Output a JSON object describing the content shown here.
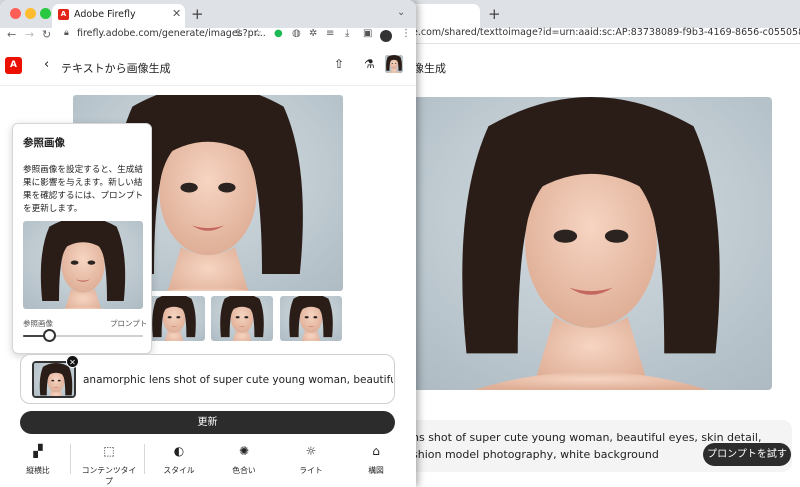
{
  "front_window": {
    "tab_title": "Adobe Firefly",
    "tab_close": "✕",
    "new_tab": "+",
    "tab_overflow": "⌄",
    "url": "firefly.adobe.com/generate/images?pr...",
    "app_title": "テキストから画像生成",
    "reference_popover": {
      "title": "参照画像",
      "description": "参照画像を設定すると、生成結果に影響を与えます。新しい結果を確認するには、プロンプトを更新します。",
      "slider_left_label": "参照画像",
      "slider_right_label": "プロンプト",
      "slider_value": 0.22
    },
    "prompt_text": "anamorphic lens shot of super cute young woman, beautiful eyes, s",
    "generate_label": "更新",
    "tools": [
      {
        "label": "縦横比",
        "icon": "aspect-ratio-icon"
      },
      {
        "label": "コンテンツタイプ",
        "icon": "content-type-icon"
      },
      {
        "label": "スタイル",
        "icon": "style-icon"
      },
      {
        "label": "色合い",
        "icon": "color-palette-icon"
      },
      {
        "label": "ライト",
        "icon": "light-icon"
      },
      {
        "label": "構図",
        "icon": "composition-icon"
      }
    ]
  },
  "back_window": {
    "new_tab": "+",
    "url": "e.com/shared/texttoimage?id=urn:aaid:sc:AP:83738089-f9b3-4169-8656-c055058d3626",
    "app_title": "像生成",
    "prompt_line1": "ns shot of super cute young woman, beautiful eyes, skin detail,",
    "prompt_line2": "shion model photography, white background",
    "try_button_label": "プロンプトを試す"
  },
  "colors": {
    "traffic_red": "#ff5f57",
    "traffic_yellow": "#febc2e",
    "traffic_green": "#28c840",
    "adobe_red": "#eb1000",
    "button_dark": "#2c2c2c"
  }
}
